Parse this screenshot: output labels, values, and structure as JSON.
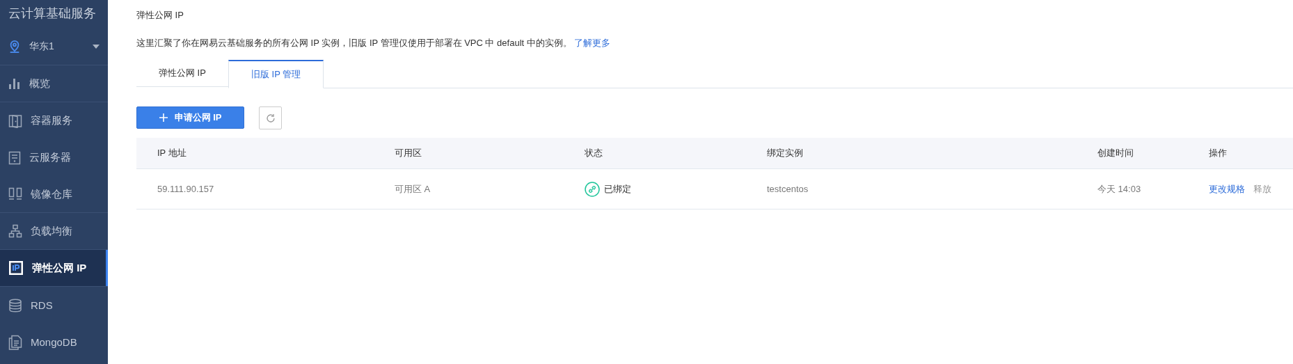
{
  "sidebar": {
    "title": "云计算基础服务",
    "region": {
      "label": "华东1"
    },
    "items": [
      {
        "label": "概览",
        "selected": false
      },
      {
        "label": "容器服务",
        "selected": false
      },
      {
        "label": "云服务器",
        "selected": false
      },
      {
        "label": "镜像仓库",
        "selected": false
      },
      {
        "label": "负载均衡",
        "selected": false
      },
      {
        "label": "弹性公网 IP",
        "selected": true
      },
      {
        "label": "RDS",
        "selected": false
      },
      {
        "label": "MongoDB",
        "selected": false
      }
    ]
  },
  "page": {
    "title": "弹性公网 IP",
    "description": "这里汇聚了你在网易云基础服务的所有公网 IP 实例，旧版 IP 管理仅使用于部署在 VPC 中 default 中的实例。",
    "link": "了解更多"
  },
  "tabs": [
    {
      "label": "弹性公网 IP",
      "selected": false
    },
    {
      "label": "旧版 IP 管理",
      "selected": true
    }
  ],
  "toolbar": {
    "primary_button": "申请公网 IP"
  },
  "table": {
    "columns": [
      "IP 地址",
      "可用区",
      "状态",
      "绑定实例",
      "创建时间",
      "操作"
    ],
    "rows": [
      {
        "ip": "59.111.90.157",
        "zone": "可用区 A",
        "status": "已绑定",
        "instance": "testcentos",
        "created": "今天 14:03",
        "actions": [
          {
            "label": "更改规格",
            "disabled": false
          },
          {
            "label": "释放",
            "disabled": true
          }
        ]
      }
    ]
  }
}
